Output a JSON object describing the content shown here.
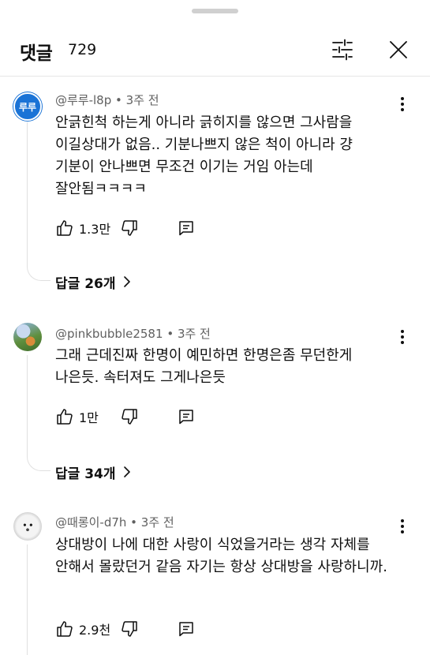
{
  "header": {
    "title": "댓글",
    "count": "729"
  },
  "comments": [
    {
      "avatar_text": "루루",
      "author": "@루루-l8p",
      "time": "3주 전",
      "text": "안긁힌척 하는게 아니라 긁히지를 않으면 그사람을 이길상대가 없음.. 기분나쁘지 않은 척이 아니라 걍 기분이 안나쁘면 무조건 이기는 거임 아는데 잘안됨ㅋㅋㅋㅋ",
      "likes": "1.3만",
      "replies": "답글 26개"
    },
    {
      "author": "@pinkbubble2581",
      "time": "3주 전",
      "text": "그래 근데진짜 한명이 예민하면 한명은좀 무던한게 나은듯. 속터져도 그게나은듯",
      "likes": "1만",
      "replies": "답글 34개"
    },
    {
      "author": "@때롱이-d7h",
      "time": "3주 전",
      "text": "상대방이 나에 대한 사랑이 식었을거라는 생각 자체를 안해서 몰랐던거 같음 자기는 항상 상대방을 사랑하니까.",
      "likes": "2.9천"
    }
  ],
  "colors": {
    "accent": "#1a73d6",
    "text": "#0f0f0f",
    "meta": "#606060"
  },
  "icons": [
    "filter-icon",
    "close-icon",
    "more-icon",
    "thumb-up-icon",
    "thumb-down-icon",
    "reply-icon",
    "chevron-right-icon"
  ]
}
